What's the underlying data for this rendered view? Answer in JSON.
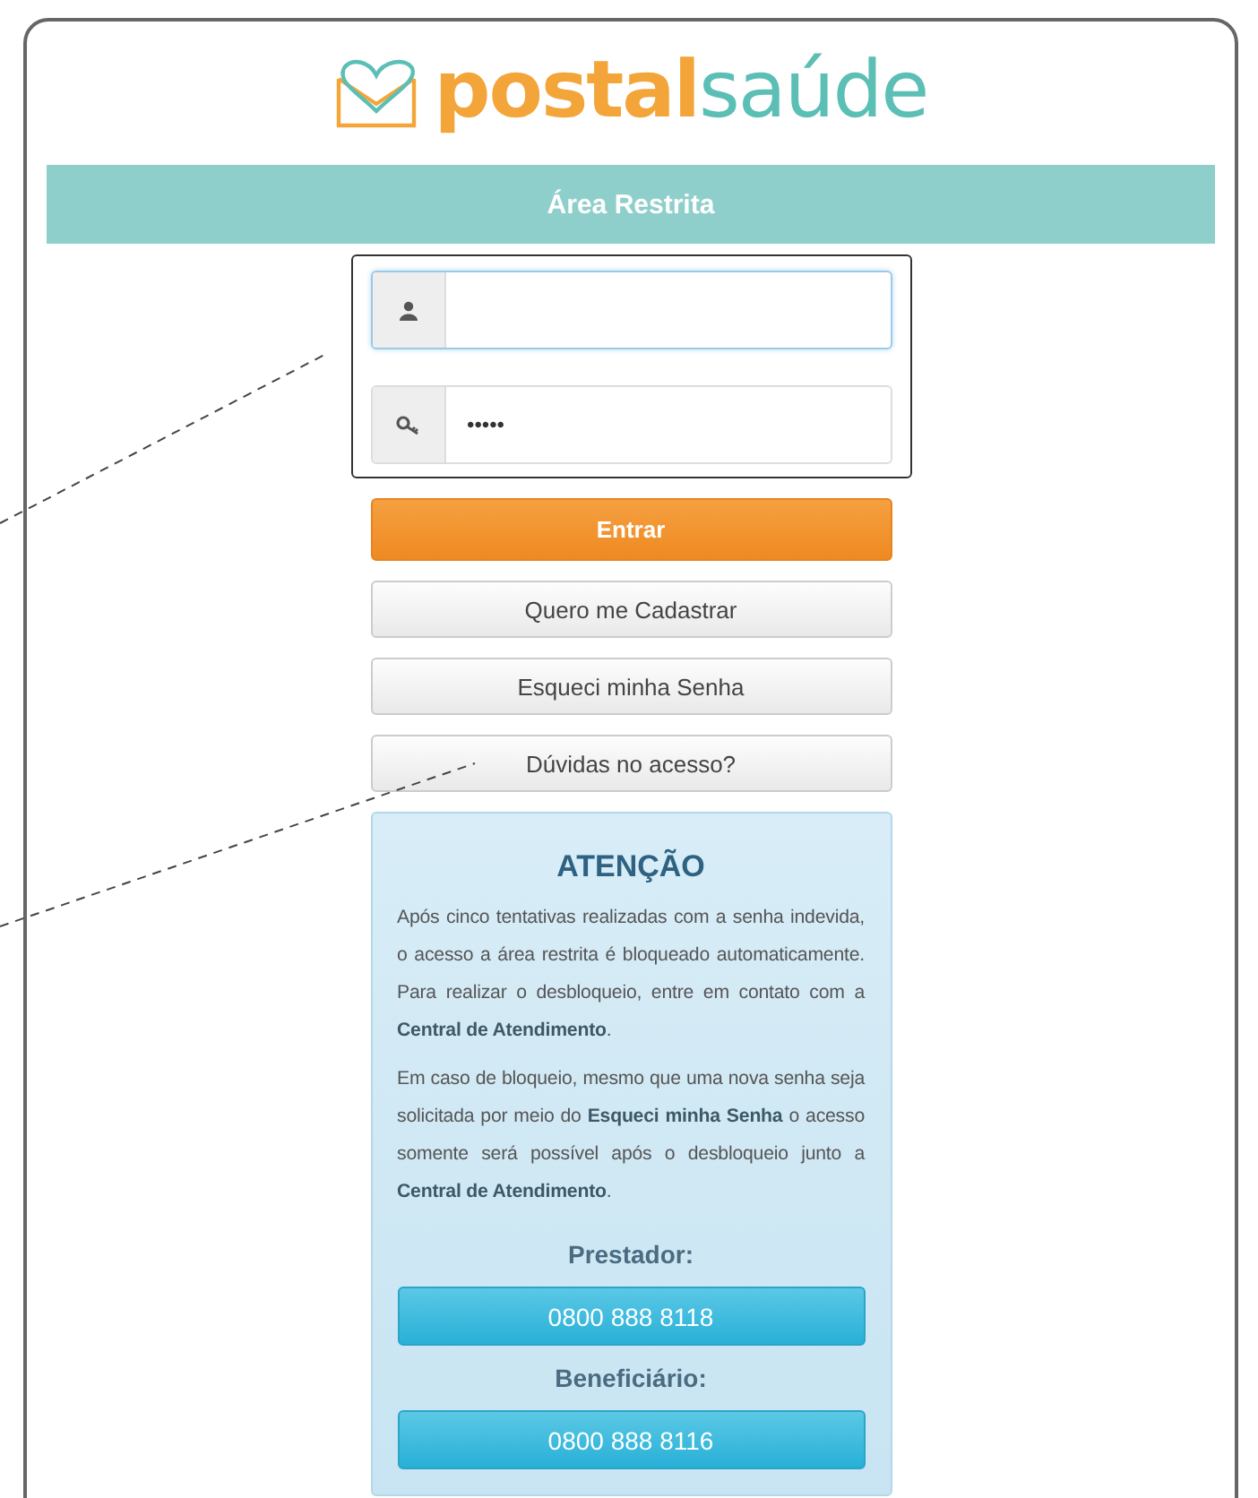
{
  "logo": {
    "part_1": "postal",
    "part_2": "saúde"
  },
  "header": "Área Restrita",
  "fields": [
    {
      "kind": "user",
      "focused": true
    },
    {
      "kind": "key",
      "value": "•••••",
      "focused": false
    }
  ],
  "buttons": [
    {
      "label": "Entrar",
      "kind": "primary"
    },
    {
      "label": "Quero me Cadastrar",
      "kind": "default"
    },
    {
      "label": "Esqueci minha Senha",
      "kind": "default"
    },
    {
      "label": "Dúvidas no acesso?",
      "kind": "default"
    }
  ],
  "notice": {
    "title": "ATENÇÃO",
    "paragraphs": [
      "Após cinco tentativas realizadas com a senha indevida, o acesso a área restrita é bloqueado automaticamente. Para realizar o desbloqueio, entre em contato com a **Central de Atendimento**.",
      "Em caso de bloqueio, mesmo que uma nova senha seja solicitada por meio do **Esqueci minha Senha** o acesso somente será possível após o desbloqueio junto a **Central de Atendimento**."
    ],
    "contacts": [
      {
        "label": "Prestador:",
        "phone": "0800 888 8118"
      },
      {
        "label": "Beneficiário:",
        "phone": "0800 888 8116"
      }
    ]
  }
}
